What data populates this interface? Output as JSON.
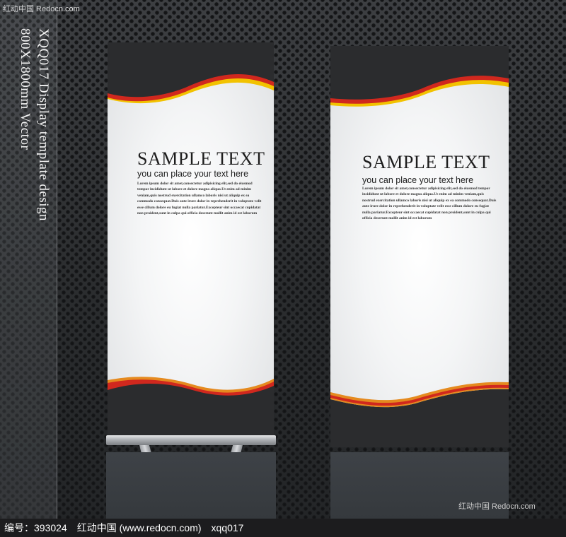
{
  "watermark": {
    "top": "红动中国 Redocn.com",
    "bottom": "红动中国 Redocn.com"
  },
  "side_label": {
    "line1": "XQQ017 Display template design",
    "line2": "800X1800mm Vector"
  },
  "banners": [
    {
      "heading": "SAMPLE TEXT",
      "subheading": "you can place your text here",
      "body": "Lorem ipsum dolor sit amet,consectetur adipisicing elit,sed do eiusmod tempor incididunt ut labore et dolore magna aliqua.Ut enim ad minim veniam,quis nostrud exercitation ullamco laboris nisi ut aliquip ex ea commodo consequat.Duis aute irure dolor in reprehenderit in voluptate velit esse cillum dolore eu fugiat nulla pariatur.Excepteur sint occaecat cupidatat non proident,sunt in culpa qui officia deserunt mollit anim id est laborum"
    },
    {
      "heading": "SAMPLE TEXT",
      "subheading": "you can place your text here",
      "body": "Lorem ipsum dolor sit amet,consectetur adipisicing elit,sed do eiusmod tempor incididunt ut labore et dolore magna aliqua.Ut enim ad minim veniam,quis nostrud exercitation ullamco laboris nisi ut aliquip ex ea commodo consequat.Duis aute irure dolor in reprehenderit in voluptate velit esse cillum dolore eu fugiat nulla pariatur.Excepteur sint occaecat cupidatat non proident,sunt in culpa qui officia deserunt mollit anim id est laborum"
    }
  ],
  "footer": {
    "id_text": "编号：393024",
    "site_text": "红动中国 (www.redocn.com)",
    "code_text": "xqq017"
  },
  "colors": {
    "band_dark": "#2b2c2e",
    "accent_red": "#d0281e",
    "accent_orange": "#e58a1f",
    "accent_yellow": "#f2c200",
    "background": "#2f3133"
  }
}
